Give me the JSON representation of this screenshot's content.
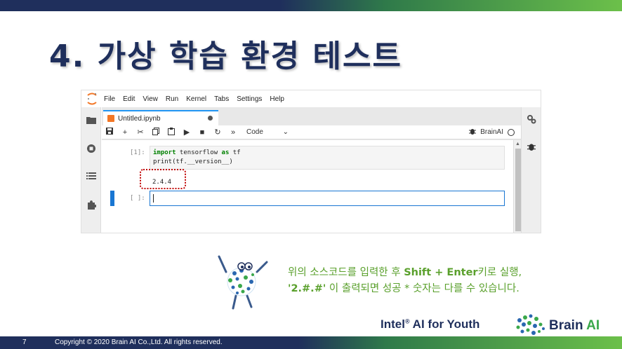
{
  "slide": {
    "title": "4. 가상 학습 환경 테스트",
    "page_number": "7",
    "copyright": "Copyright © 2020 Brain AI Co.,Ltd. All rights reserved.",
    "footer_brand_main": "Intel",
    "footer_brand_reg": "®",
    "footer_brand_rest": " AI for Youth",
    "logo_brain": "Brain",
    "logo_ai": "AI"
  },
  "instruction": {
    "line1_a": "위의 소스코드를 입력한 후 ",
    "line1_keys": "Shift + Enter",
    "line1_b": "키로 실행,",
    "line2_code": "'2.#.#'",
    "line2_rest": " 이 출력되면 성공 * 숫자는 다를 수 있습니다."
  },
  "jupyter": {
    "menu": [
      "File",
      "Edit",
      "View",
      "Run",
      "Kernel",
      "Tabs",
      "Settings",
      "Help"
    ],
    "tab_title": "Untitled.ipynb",
    "cell_type": "Code",
    "kernel_name": "BrainAI",
    "cells": [
      {
        "prompt": "[1]:",
        "code_line1_kw1": "import",
        "code_line1_mid": " tensorflow ",
        "code_line1_kw2": "as",
        "code_line1_end": " tf",
        "code_line2": "print(tf.__version__)",
        "output": "2.4.4"
      },
      {
        "prompt": "[ ]:",
        "code": ""
      }
    ]
  },
  "colors": {
    "title": "#1f2f5c",
    "instruction": "#5aa02c",
    "accent_blue": "#1976d2",
    "highlight": "#c00000"
  }
}
